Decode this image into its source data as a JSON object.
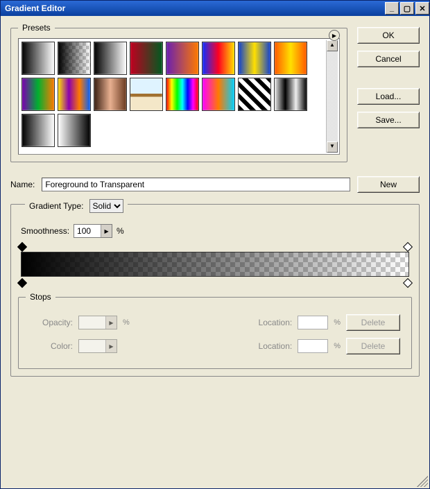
{
  "title": "Gradient Editor",
  "buttons": {
    "ok": "OK",
    "cancel": "Cancel",
    "load": "Load...",
    "save": "Save...",
    "new": "New",
    "delete": "Delete"
  },
  "presets": {
    "legend": "Presets",
    "items": [
      {
        "name": "black-white",
        "css": "linear-gradient(to right,#000,#fff)"
      },
      {
        "name": "fg-transparent",
        "css": "linear-gradient(to right,#000,rgba(0,0,0,0)),repeating-conic-gradient(#ccc 0 25%, #fff 0 50%) 0 0/10px 10px"
      },
      {
        "name": "black-white-soft",
        "css": "linear-gradient(to right,#000,#fff)"
      },
      {
        "name": "red-green",
        "css": "linear-gradient(to right,#c00020,#005a20)"
      },
      {
        "name": "violet-orange",
        "css": "linear-gradient(to right,#6a1fb0,#ff7a00)"
      },
      {
        "name": "blue-red-yellow",
        "css": "linear-gradient(to right,#1030ff,#ff0020,#ffe000)"
      },
      {
        "name": "blue-yellow-blue",
        "css": "linear-gradient(to right,#1040d0,#ffe000,#1040d0)"
      },
      {
        "name": "orange-yellow-orange",
        "css": "linear-gradient(to right,#ff5a00,#ffe000,#ff5a00)"
      },
      {
        "name": "violet-green-orange",
        "css": "linear-gradient(to right,#7a00b0,#00b030,#ff7a00)"
      },
      {
        "name": "yellow-violet-orange-blue",
        "css": "linear-gradient(to right,#ffe000,#8a00b0,#ff7a00,#0060ff)"
      },
      {
        "name": "copper",
        "css": "linear-gradient(to right,#3a1f12,#e8b090,#6a3a20)"
      },
      {
        "name": "chrome",
        "css": "linear-gradient(to bottom,#dff3ff 0 48%,#a17030 48% 58%,#f4e7c8 58% 100%)"
      },
      {
        "name": "spectrum",
        "css": "linear-gradient(to right,red,yellow,lime,cyan,blue,magenta,red)"
      },
      {
        "name": "transparent-rainbow",
        "css": "linear-gradient(to right,#ff00ff,#ff7a00,#00d0ff),repeating-conic-gradient(#ccc 0 25%, #fff 0 50%) 0 0/10px 10px"
      },
      {
        "name": "stripes-bw",
        "css": "repeating-linear-gradient(45deg,#000 0 6px,#fff 6px 12px)"
      },
      {
        "name": "black-white-alt",
        "css": "linear-gradient(to right,#eee,#000,#eee,#000)"
      },
      {
        "name": "black-white-dup",
        "css": "linear-gradient(to right,#000,#fff)"
      },
      {
        "name": "white-black",
        "css": "linear-gradient(to right,#fff,#000)"
      }
    ]
  },
  "name_field": {
    "label": "Name:",
    "value": "Foreground to Transparent"
  },
  "gradient_type": {
    "label": "Gradient Type:",
    "value": "Solid"
  },
  "smoothness": {
    "label": "Smoothness:",
    "value": "100",
    "unit": "%"
  },
  "stops": {
    "legend": "Stops",
    "opacity_label": "Opacity:",
    "color_label": "Color:",
    "location_label": "Location:",
    "unit": "%"
  }
}
